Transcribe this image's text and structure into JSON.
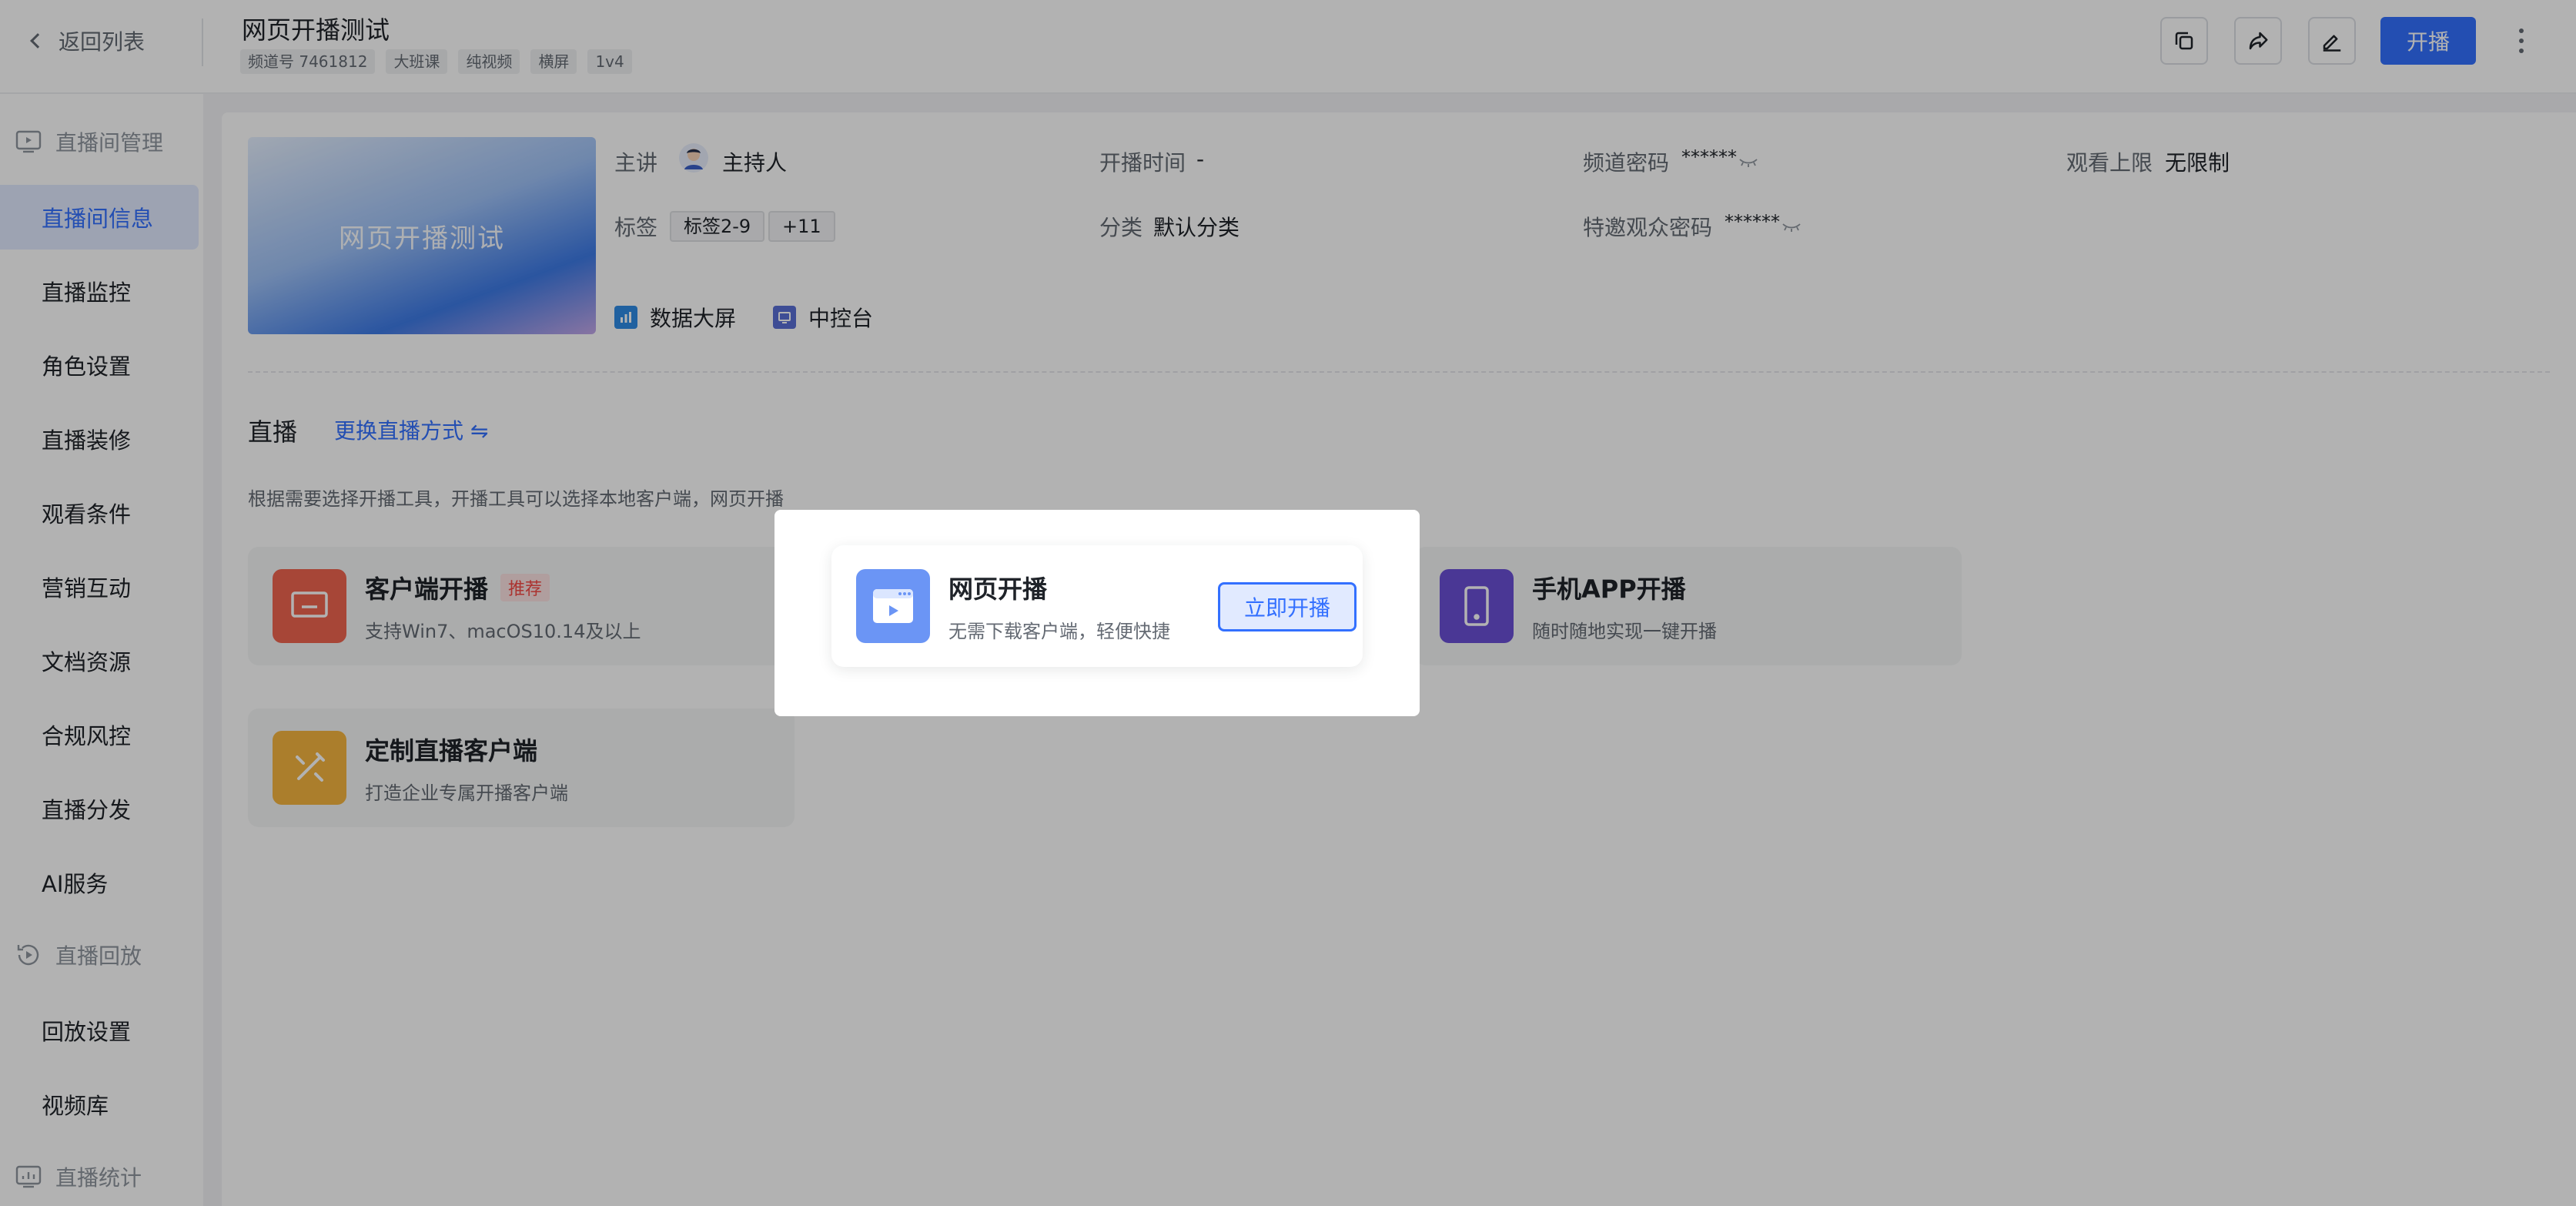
{
  "header": {
    "back_label": "返回列表",
    "title": "网页开播测试",
    "tags": [
      "频道号 7461812",
      "大班课",
      "纯视频",
      "横屏",
      "1v4"
    ],
    "start_label": "开播"
  },
  "sidebar": {
    "group_live": "直播间管理",
    "items": [
      "直播间信息",
      "直播监控",
      "角色设置",
      "直播装修",
      "观看条件",
      "营销互动",
      "文档资源",
      "合规风控",
      "直播分发",
      "AI服务"
    ],
    "group_replay": "直播回放",
    "replay_items": [
      "回放设置",
      "视频库"
    ],
    "group_stats": "直播统计"
  },
  "info": {
    "cover_title": "网页开播测试",
    "speaker_label": "主讲",
    "speaker_value": "主持人",
    "time_label": "开播时间",
    "time_value": "-",
    "password_label": "频道密码",
    "password_value": "******",
    "limit_label": "观看上限",
    "limit_value": "无限制",
    "tag_label": "标签",
    "tag_value": "标签2-9",
    "tag_more": "+11",
    "category_label": "分类",
    "category_value": "默认分类",
    "vip_password_label": "特邀观众密码",
    "vip_password_value": "******",
    "data_screen": "数据大屏",
    "control_panel": "中控台"
  },
  "live": {
    "section_title": "直播",
    "switch_mode": "更换直播方式 ⇋",
    "hint": "根据需要选择开播工具，开播工具可以选择本地客户端，网页开播",
    "modes": [
      {
        "title": "客户端开播",
        "badge": "推荐",
        "desc": "支持Win7、macOS10.14及以上"
      },
      {
        "title": "网页开播",
        "desc": "无需下载客户端，轻便快捷",
        "action": "立即开播"
      },
      {
        "title": "手机APP开播",
        "desc": "随时随地实现一键开播"
      },
      {
        "title": "定制直播客户端",
        "desc": "打造企业专属开播客户端"
      }
    ]
  },
  "colors": {
    "accent": "#3370ff",
    "client_icon": "#f0654f",
    "web_icon": "#6b95f5",
    "app_icon": "#6a4fd6",
    "custom_icon": "#f5b53f"
  }
}
